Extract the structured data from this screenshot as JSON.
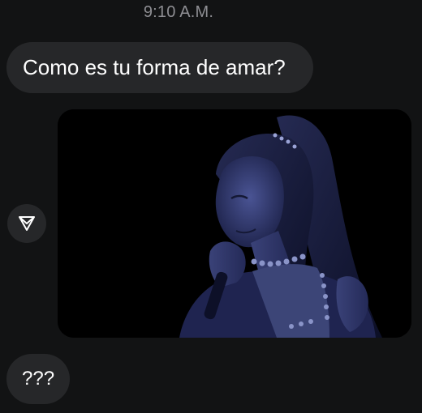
{
  "chat": {
    "timestamp": "9:10 A.M.",
    "messages": [
      {
        "type": "text",
        "text": "Como es tu forma de amar?"
      },
      {
        "type": "image",
        "description_icon": "portrait-photo"
      },
      {
        "type": "text",
        "text": "???"
      }
    ],
    "share_icon": "send-arrow-icon"
  },
  "colors": {
    "background": "#121314",
    "bubble": "#262729",
    "text": "#ffffff",
    "timestamp": "#8e8e93",
    "photo_tint": "#2a3160"
  }
}
